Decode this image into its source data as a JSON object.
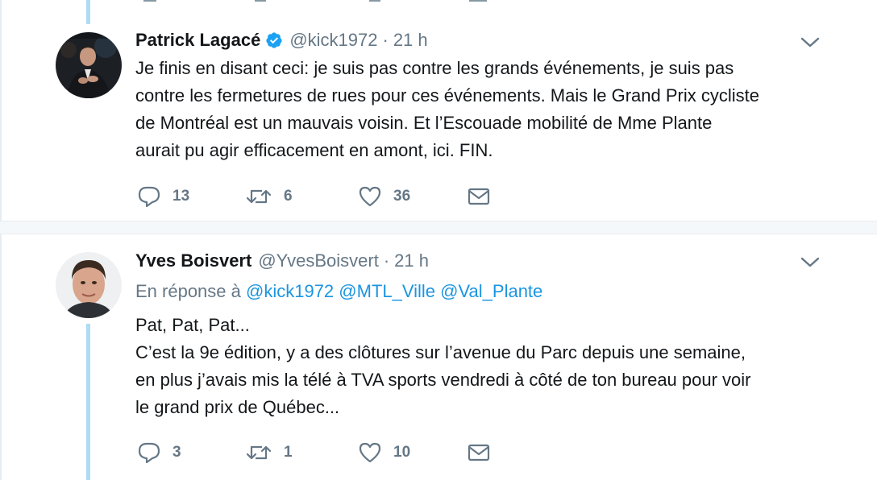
{
  "colors": {
    "thread_line": "#aedcf3",
    "mention": "#1b95e0",
    "secondary_text": "#657786",
    "verified": "#1da1f2"
  },
  "tweets": [
    {
      "fullname": "Patrick Lagacé",
      "verified": true,
      "handle": "@kick1972",
      "separator": "·",
      "time": "21 h",
      "text_lines": [
        "Je finis en disant ceci: je suis pas contre les grands événements, je suis pas",
        "contre les fermetures de rues pour ces événements. Mais le Grand Prix cycliste",
        "de Montréal est un mauvais voisin. Et l’Escouade mobilité de Mme Plante",
        "aurait pu agir efficacement en amont, ici. FIN."
      ],
      "actions": {
        "replies": "13",
        "retweets": "6",
        "likes": "36"
      },
      "icons": [
        "reply-icon",
        "retweet-icon",
        "heart-icon",
        "envelope-icon",
        "chevron-down-icon",
        "verified-badge-icon"
      ]
    },
    {
      "fullname": "Yves Boisvert",
      "verified": false,
      "handle": "@YvesBoisvert",
      "separator": "·",
      "time": "21 h",
      "reply_prefix": "En réponse à",
      "reply_mentions": [
        "@kick1972",
        "@MTL_Ville",
        "@Val_Plante"
      ],
      "text_lines": [
        "Pat, Pat, Pat...",
        "C’est la 9e édition, y a des clôtures sur l’avenue du Parc depuis une semaine,",
        "en plus j’avais mis la télé à TVA sports vendredi à côté de ton bureau pour voir",
        "le grand prix de Québec..."
      ],
      "actions": {
        "replies": "3",
        "retweets": "1",
        "likes": "10"
      },
      "icons": [
        "reply-icon",
        "retweet-icon",
        "heart-icon",
        "envelope-icon",
        "chevron-down-icon"
      ]
    }
  ]
}
